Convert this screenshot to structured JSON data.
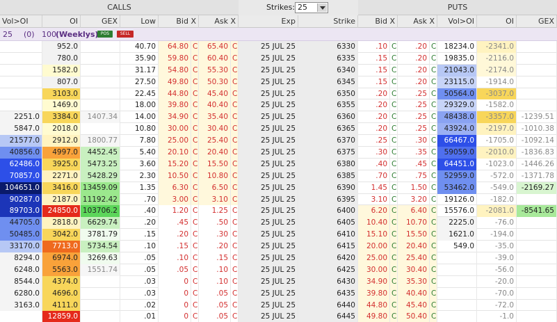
{
  "top": {
    "calls": "CALLS",
    "strikes_label": "Strikes:",
    "strikes_value": "25",
    "puts": "PUTS"
  },
  "headers": [
    "Vol>OI",
    "OI",
    "GEX",
    "Low",
    "Bid X",
    "Ask X",
    "Exp",
    "Strike",
    "Bid X",
    "Ask X",
    "Vol>OI",
    "OI",
    "GEX"
  ],
  "weekly": {
    "count": "25",
    "paren": "(0)",
    "days": "100",
    "label": "(Weeklys)",
    "pos": "POS",
    "sell": "SELL"
  },
  "colors": {
    "pale_yellow": "#fffbd0",
    "yellow": "#fbe97a",
    "gold": "#f8d65a",
    "orange": "#f9a23a",
    "deep_orange": "#ef6a1e",
    "red": "#e52a1a",
    "light_green": "#c9f0c0",
    "green": "#9be88d",
    "bright_green": "#5cd65a",
    "blue_light": "#b7c8f5",
    "blue_mid": "#6f8ff0",
    "blue_deep": "#2d4fe8",
    "navy": "#0a1a6a"
  },
  "rows": [
    {
      "cvol": "",
      "cvolc": "",
      "coi": "952.0",
      "coic": "#f2f2f2",
      "cgex": "",
      "cgexc": "",
      "low": "40.70",
      "cb": "64.80",
      "cbx": "C",
      "ca": "65.40",
      "cax": "C",
      "exp": "25 JUL 25",
      "strike": "6330",
      "pb": ".10",
      "pbx": "C",
      "pa": ".20",
      "pax": "C",
      "pvol": "18234.0",
      "pvolc": "",
      "poi": "-2341.0",
      "poic": "#fff3c0",
      "pgex": "",
      "pgexc": ""
    },
    {
      "cvol": "",
      "cvolc": "",
      "coi": "780.0",
      "coic": "#f2f2f2",
      "cgex": "",
      "cgexc": "",
      "low": "35.90",
      "cb": "59.80",
      "cbx": "C",
      "ca": "60.40",
      "cax": "C",
      "exp": "25 JUL 25",
      "strike": "6335",
      "pb": ".15",
      "pbx": "C",
      "pa": ".20",
      "pax": "C",
      "pvol": "19835.0",
      "pvolc": "",
      "poi": "-2116.0",
      "poic": "#fff8d8",
      "pgex": "",
      "pgexc": ""
    },
    {
      "cvol": "",
      "cvolc": "",
      "coi": "1582.0",
      "coic": "#fffbd0",
      "cgex": "",
      "cgexc": "",
      "low": "31.17",
      "cb": "54.80",
      "cbx": "C",
      "ca": "55.30",
      "cax": "C",
      "exp": "25 JUL 25",
      "strike": "6340",
      "pb": ".15",
      "pbx": "C",
      "pa": ".20",
      "pax": "C",
      "pvol": "21043.0",
      "pvolc": "#b7c8f5",
      "poi": "-2174.0",
      "poic": "#fff8d8",
      "pgex": "",
      "pgexc": ""
    },
    {
      "cvol": "",
      "cvolc": "",
      "coi": "807.0",
      "coic": "#f2f2f2",
      "cgex": "",
      "cgexc": "",
      "low": "27.50",
      "cb": "49.80",
      "cbx": "C",
      "ca": "50.30",
      "cax": "C",
      "exp": "25 JUL 25",
      "strike": "6345",
      "pb": ".15",
      "pbx": "C",
      "pa": ".20",
      "pax": "C",
      "pvol": "23115.0",
      "pvolc": "#c7d4f8",
      "poi": "-1914.0",
      "poic": "",
      "pgex": "",
      "pgexc": ""
    },
    {
      "cvol": "",
      "cvolc": "",
      "coi": "3103.0",
      "coic": "#f8d65a",
      "cgex": "",
      "cgexc": "",
      "low": "22.45",
      "cb": "44.80",
      "cbx": "C",
      "ca": "45.40",
      "cax": "C",
      "exp": "25 JUL 25",
      "strike": "6350",
      "pb": ".20",
      "pbx": "C",
      "pa": ".25",
      "pax": "C",
      "pvol": "50564.0",
      "pvolc": "#6f8ff0",
      "poi": "-3037.0",
      "poic": "#f8d65a",
      "pgex": "",
      "pgexc": ""
    },
    {
      "cvol": "",
      "cvolc": "",
      "coi": "1469.0",
      "coic": "#fffbd0",
      "cgex": "",
      "cgexc": "",
      "low": "18.00",
      "cb": "39.80",
      "cbx": "C",
      "ca": "40.40",
      "cax": "C",
      "exp": "25 JUL 25",
      "strike": "6355",
      "pb": ".20",
      "pbx": "C",
      "pa": ".25",
      "pax": "C",
      "pvol": "29329.0",
      "pvolc": "#c7d4f8",
      "poi": "-1582.0",
      "poic": "",
      "pgex": "",
      "pgexc": ""
    },
    {
      "cvol": "2251.0",
      "cvolc": "#f4f4f4",
      "coi": "3384.0",
      "coic": "#f8d65a",
      "cgex": "1407.34",
      "cgexc": "#f6f6f6",
      "low": "14.00",
      "cb": "34.90",
      "cbx": "C",
      "ca": "35.40",
      "cax": "C",
      "exp": "25 JUL 25",
      "strike": "6360",
      "pb": ".20",
      "pbx": "C",
      "pa": ".25",
      "pax": "C",
      "pvol": "48438.0",
      "pvolc": "#8aa3f2",
      "poi": "-3357.0",
      "poic": "#f8d65a",
      "pgex": "-1239.51",
      "pgexc": ""
    },
    {
      "cvol": "5847.0",
      "cvolc": "#f4f4f4",
      "coi": "2018.0",
      "coic": "#fffbd0",
      "cgex": "",
      "cgexc": "",
      "low": "10.80",
      "cb": "30.00",
      "cbx": "C",
      "ca": "30.40",
      "cax": "C",
      "exp": "25 JUL 25",
      "strike": "6365",
      "pb": ".20",
      "pbx": "C",
      "pa": ".25",
      "pax": "C",
      "pvol": "43924.0",
      "pvolc": "#9bb0f3",
      "poi": "-2197.0",
      "poic": "#fff3c0",
      "pgex": "-1010.38",
      "pgexc": ""
    },
    {
      "cvol": "21577.0",
      "cvolc": "#b7c8f5",
      "coi": "2912.0",
      "coic": "#fff3c0",
      "cgex": "1800.77",
      "cgexc": "#f6f6f6",
      "low": "7.80",
      "cb": "25.00",
      "cbx": "C",
      "ca": "25.40",
      "cax": "C",
      "exp": "25 JUL 25",
      "strike": "6370",
      "pb": ".25",
      "pbx": "C",
      "pa": ".30",
      "pax": "C",
      "pvol": "66467.0",
      "pvolc": "#2d4fe8",
      "poi": "-1705.0",
      "poic": "",
      "pgex": "-1092.14",
      "pgexc": ""
    },
    {
      "cvol": "40856.0",
      "cvolc": "#6f8ff0",
      "coi": "4997.0",
      "coic": "#f9a23a",
      "cgex": "4452.45",
      "cgexc": "#c9f0c0",
      "low": "5.40",
      "cb": "20.10",
      "cbx": "C",
      "ca": "20.40",
      "cax": "C",
      "exp": "25 JUL 25",
      "strike": "6375",
      "pb": ".30",
      "pbx": "C",
      "pa": ".35",
      "pax": "C",
      "pvol": "59059.0",
      "pvolc": "#4f6fee",
      "poi": "-2010.0",
      "poic": "#fff3c0",
      "pgex": "-1836.83",
      "pgexc": ""
    },
    {
      "cvol": "62486.0",
      "cvolc": "#2d4fe8",
      "coi": "3925.0",
      "coic": "#f8d65a",
      "cgex": "5473.25",
      "cgexc": "#c9f0c0",
      "low": "3.60",
      "cb": "15.20",
      "cbx": "C",
      "ca": "15.50",
      "cax": "C",
      "exp": "25 JUL 25",
      "strike": "6380",
      "pb": ".40",
      "pbx": "C",
      "pa": ".45",
      "pax": "C",
      "pvol": "64451.0",
      "pvolc": "#2d4fe8",
      "poi": "-1023.0",
      "poic": "",
      "pgex": "-1446.26",
      "pgexc": ""
    },
    {
      "cvol": "70857.0",
      "cvolc": "#2d4fe8",
      "coi": "2271.0",
      "coic": "#fff3c0",
      "cgex": "5428.29",
      "cgexc": "#c9f0c0",
      "low": "2.30",
      "cb": "10.50",
      "cbx": "C",
      "ca": "10.80",
      "cax": "C",
      "exp": "25 JUL 25",
      "strike": "6385",
      "pb": ".70",
      "pbx": "C",
      "pa": ".75",
      "pax": "C",
      "pvol": "52959.0",
      "pvolc": "#6f8ff0",
      "poi": "-572.0",
      "poic": "",
      "pgex": "-1371.78",
      "pgexc": ""
    },
    {
      "cvol": "104651.0",
      "cvolc": "#0a1a6a",
      "coi": "3416.0",
      "coic": "#f8d65a",
      "cgex": "13459.09",
      "cgexc": "#9be88d",
      "low": "1.35",
      "cb": "6.30",
      "cbx": "C",
      "ca": "6.50",
      "cax": "C",
      "exp": "25 JUL 25",
      "strike": "6390",
      "pb": "1.45",
      "pbx": "C",
      "pa": "1.50",
      "pax": "C",
      "pvol": "53462.0",
      "pvolc": "#6f8ff0",
      "poi": "-549.0",
      "poic": "",
      "pgex": "-2169.27",
      "pgexc": "#d8f5d0"
    },
    {
      "cvol": "90287.0",
      "cvolc": "#1c35b8",
      "coi": "2187.0",
      "coic": "#fff3c0",
      "cgex": "11192.42",
      "cgexc": "#9be88d",
      "low": ".70",
      "cb": "3.00",
      "cbx": "C",
      "ca": "3.10",
      "cax": "C",
      "exp": "25 JUL 25",
      "strike": "6395",
      "pb": "3.10",
      "pbx": "C",
      "pa": "3.20",
      "pax": "C",
      "pvol": "19126.0",
      "pvolc": "",
      "poi": "-182.0",
      "poic": "",
      "pgex": "",
      "pgexc": ""
    },
    {
      "cvol": "89703.0",
      "cvolc": "#1c35b8",
      "coi": "24850.0",
      "coic": "#e52a1a",
      "cgex": "103706.2",
      "cgexc": "#5cd65a",
      "low": ".40",
      "cb": "1.20",
      "cbx": "C",
      "ca": "1.25",
      "cax": "C",
      "exp": "25 JUL 25",
      "strike": "6400",
      "pb": "6.20",
      "pbx": "C",
      "pa": "6.40",
      "pax": "C",
      "pvol": "15576.0",
      "pvolc": "",
      "poi": "-2081.0",
      "poic": "#fff3c0",
      "pgex": "-8541.65",
      "pgexc": "#a8e99a"
    },
    {
      "cvol": "44705.0",
      "cvolc": "#6f8ff0",
      "coi": "2818.0",
      "coic": "#fff3c0",
      "cgex": "6629.74",
      "cgexc": "#c9f0c0",
      "low": ".20",
      "cb": ".45",
      "cbx": "C",
      "ca": ".50",
      "cax": "C",
      "exp": "25 JUL 25",
      "strike": "6405",
      "pb": "10.40",
      "pbx": "C",
      "pa": "10.70",
      "pax": "C",
      "pvol": "2225.0",
      "pvolc": "#f4f4f4",
      "poi": "-76.0",
      "poic": "",
      "pgex": "",
      "pgexc": ""
    },
    {
      "cvol": "50485.0",
      "cvolc": "#6f8ff0",
      "coi": "3042.0",
      "coic": "#f8d65a",
      "cgex": "3781.79",
      "cgexc": "#f0fbee",
      "low": ".15",
      "cb": ".20",
      "cbx": "C",
      "ca": ".30",
      "cax": "C",
      "exp": "25 JUL 25",
      "strike": "6410",
      "pb": "15.10",
      "pbx": "C",
      "pa": "15.50",
      "pax": "C",
      "pvol": "1621.0",
      "pvolc": "#f4f4f4",
      "poi": "-194.0",
      "poic": "",
      "pgex": "",
      "pgexc": ""
    },
    {
      "cvol": "33170.0",
      "cvolc": "#b7c8f5",
      "coi": "7713.0",
      "coic": "#ef6a1e",
      "cgex": "5734.54",
      "cgexc": "#c9f0c0",
      "low": ".10",
      "cb": ".15",
      "cbx": "C",
      "ca": ".20",
      "cax": "C",
      "exp": "25 JUL 25",
      "strike": "6415",
      "pb": "20.00",
      "pbx": "C",
      "pa": "20.40",
      "pax": "C",
      "pvol": "549.0",
      "pvolc": "",
      "poi": "-35.0",
      "poic": "",
      "pgex": "",
      "pgexc": ""
    },
    {
      "cvol": "8294.0",
      "cvolc": "#f4f4f4",
      "coi": "6974.0",
      "coic": "#f9a23a",
      "cgex": "3269.63",
      "cgexc": "#f0fbee",
      "low": ".05",
      "cb": ".10",
      "cbx": "C",
      "ca": ".15",
      "cax": "C",
      "exp": "25 JUL 25",
      "strike": "6420",
      "pb": "25.00",
      "pbx": "C",
      "pa": "25.40",
      "pax": "C",
      "pvol": "",
      "pvolc": "",
      "poi": "-39.0",
      "poic": "",
      "pgex": "",
      "pgexc": ""
    },
    {
      "cvol": "6248.0",
      "cvolc": "#f4f4f4",
      "coi": "5563.0",
      "coic": "#f9a23a",
      "cgex": "1551.74",
      "cgexc": "#f6f6f6",
      "low": ".05",
      "cb": ".05",
      "cbx": "C",
      "ca": ".10",
      "cax": "C",
      "exp": "25 JUL 25",
      "strike": "6425",
      "pb": "30.00",
      "pbx": "C",
      "pa": "30.40",
      "pax": "C",
      "pvol": "",
      "pvolc": "",
      "poi": "-56.0",
      "poic": "",
      "pgex": "",
      "pgexc": ""
    },
    {
      "cvol": "8544.0",
      "cvolc": "#f4f4f4",
      "coi": "4374.0",
      "coic": "#f8d65a",
      "cgex": "",
      "cgexc": "",
      "low": ".03",
      "cb": "0",
      "cbx": "C",
      "ca": ".10",
      "cax": "C",
      "exp": "25 JUL 25",
      "strike": "6430",
      "pb": "34.90",
      "pbx": "C",
      "pa": "35.30",
      "pax": "C",
      "pvol": "",
      "pvolc": "",
      "poi": "-20.0",
      "poic": "",
      "pgex": "",
      "pgexc": ""
    },
    {
      "cvol": "6280.0",
      "cvolc": "#f4f4f4",
      "coi": "4696.0",
      "coic": "#f8d65a",
      "cgex": "",
      "cgexc": "",
      "low": ".03",
      "cb": "0",
      "cbx": "C",
      "ca": ".05",
      "cax": "C",
      "exp": "25 JUL 25",
      "strike": "6435",
      "pb": "39.80",
      "pbx": "C",
      "pa": "40.40",
      "pax": "C",
      "pvol": "",
      "pvolc": "",
      "poi": "-70.0",
      "poic": "",
      "pgex": "",
      "pgexc": ""
    },
    {
      "cvol": "3163.0",
      "cvolc": "#f4f4f4",
      "coi": "4111.0",
      "coic": "#f8d65a",
      "cgex": "",
      "cgexc": "",
      "low": ".02",
      "cb": "0",
      "cbx": "C",
      "ca": ".05",
      "cax": "C",
      "exp": "25 JUL 25",
      "strike": "6440",
      "pb": "44.80",
      "pbx": "C",
      "pa": "45.40",
      "pax": "C",
      "pvol": "",
      "pvolc": "",
      "poi": "-72.0",
      "poic": "",
      "pgex": "",
      "pgexc": ""
    },
    {
      "cvol": "",
      "cvolc": "",
      "coi": "12859.0",
      "coic": "#e52a1a",
      "cgex": "",
      "cgexc": "",
      "low": ".01",
      "cb": "0",
      "cbx": "C",
      "ca": ".05",
      "cax": "C",
      "exp": "25 JUL 25",
      "strike": "6445",
      "pb": "49.80",
      "pbx": "C",
      "pa": "50.40",
      "pax": "C",
      "pvol": "",
      "pvolc": "",
      "poi": "-1.0",
      "poic": "",
      "pgex": "",
      "pgexc": ""
    },
    {
      "cvol": "",
      "cvolc": "",
      "coi": "16302.0",
      "coic": "#e52a1a",
      "cgex": "",
      "cgexc": "",
      "low": ".01",
      "cb": "0",
      "cbx": "C",
      "ca": ".05",
      "cax": "C",
      "exp": "25 JUL 25",
      "strike": "6450",
      "pb": "54.80",
      "pbx": "C",
      "pa": "55.40",
      "pax": "C",
      "pvol": "",
      "pvolc": "",
      "poi": "-34.0",
      "poic": "",
      "pgex": "",
      "pgexc": ""
    }
  ]
}
